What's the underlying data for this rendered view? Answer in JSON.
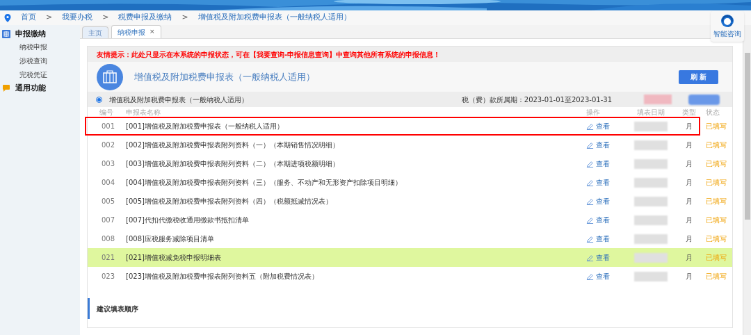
{
  "breadcrumb": {
    "separator": ">",
    "items": [
      "首页",
      "我要办税",
      "税费申报及缴纳",
      "增值税及附加税费申报表（一般纳税人适用）"
    ]
  },
  "sidebar": {
    "groups": [
      {
        "label": "申报缴纳",
        "kind": "declare",
        "children": [
          "纳税申报",
          "涉税查询",
          "完税凭证"
        ]
      },
      {
        "label": "通用功能",
        "kind": "chat"
      }
    ]
  },
  "tabs": [
    {
      "label": "主页",
      "selected": false
    },
    {
      "label": "纳税申报",
      "selected": true,
      "close": "×"
    }
  ],
  "assistant": {
    "label": "智能咨询"
  },
  "notice": "友情提示：此处只显示在本系统的申报状态，可在【我要查询-申报信息查询】中查询其他所有系统的申报信息！",
  "form_title": "增值税及附加税费申报表（一般纳税人适用）",
  "refresh_button": "刷 新",
  "option": {
    "label": "增值税及附加税费申报表（一般纳税人适用）",
    "selected": true
  },
  "period": "税（费）款所属期：2023-01-01至2023-01-31",
  "table": {
    "columns": [
      "编号",
      "申报表名称",
      "操作",
      "填表日期",
      "类型",
      "状态"
    ],
    "rows": [
      {
        "code": "001",
        "name": "[001]增值税及附加税费申报表（一般纳税人适用）",
        "action": "查看",
        "type": "月",
        "status": "已填写",
        "selected": false,
        "outlined": true
      },
      {
        "code": "002",
        "name": "[002]增值税及附加税费申报表附列资料（一）（本期销售情况明细）",
        "action": "查看",
        "type": "月",
        "status": "已填写",
        "selected": false,
        "outlined": false
      },
      {
        "code": "003",
        "name": "[003]增值税及附加税费申报表附列资料（二）（本期进项税额明细）",
        "action": "查看",
        "type": "月",
        "status": "已填写",
        "selected": false,
        "outlined": false
      },
      {
        "code": "004",
        "name": "[004]增值税及附加税费申报表附列资料（三）（服务、不动产和无形资产扣除项目明细）",
        "action": "查看",
        "type": "月",
        "status": "已填写",
        "selected": false,
        "outlined": false
      },
      {
        "code": "005",
        "name": "[005]增值税及附加税费申报表附列资料（四）（税额抵减情况表）",
        "action": "查看",
        "type": "月",
        "status": "已填写",
        "selected": false,
        "outlined": false
      },
      {
        "code": "007",
        "name": "[007]代扣代缴税收通用缴款书抵扣清单",
        "action": "查看",
        "type": "月",
        "status": "已填写",
        "selected": false,
        "outlined": false
      },
      {
        "code": "008",
        "name": "[008]应税服务减除项目清单",
        "action": "查看",
        "type": "月",
        "status": "已填写",
        "selected": false,
        "outlined": false
      },
      {
        "code": "021",
        "name": "[021]增值税减免税申报明细表",
        "action": "查看",
        "type": "月",
        "status": "已填写",
        "selected": true,
        "outlined": false
      },
      {
        "code": "023",
        "name": "[023]增值税及附加税费申报表附列资料五（附加税费情况表）",
        "action": "查看",
        "type": "月",
        "status": "已填写",
        "selected": false,
        "outlined": false
      }
    ]
  },
  "section_title": "建议填表顺序"
}
